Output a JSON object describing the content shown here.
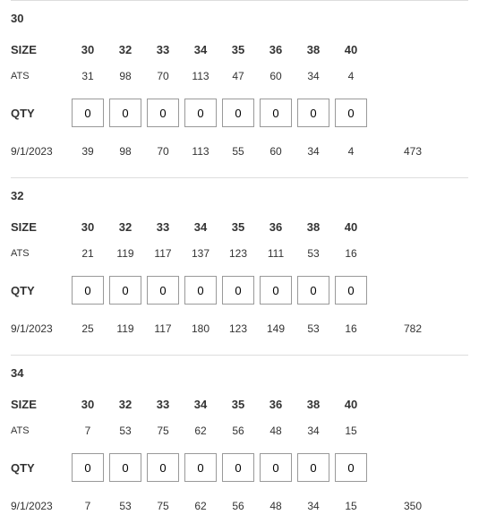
{
  "labels": {
    "size": "SIZE",
    "ats": "ATS",
    "qty": "QTY"
  },
  "groups": [
    {
      "title": "30",
      "sizes": [
        "30",
        "32",
        "33",
        "34",
        "35",
        "36",
        "38",
        "40"
      ],
      "ats": [
        "31",
        "98",
        "70",
        "113",
        "47",
        "60",
        "34",
        "4"
      ],
      "qty": [
        "0",
        "0",
        "0",
        "0",
        "0",
        "0",
        "0",
        "0"
      ],
      "date": "9/1/2023",
      "dateVals": [
        "39",
        "98",
        "70",
        "113",
        "55",
        "60",
        "34",
        "4"
      ],
      "total": "473"
    },
    {
      "title": "32",
      "sizes": [
        "30",
        "32",
        "33",
        "34",
        "35",
        "36",
        "38",
        "40"
      ],
      "ats": [
        "21",
        "119",
        "117",
        "137",
        "123",
        "111",
        "53",
        "16"
      ],
      "qty": [
        "0",
        "0",
        "0",
        "0",
        "0",
        "0",
        "0",
        "0"
      ],
      "date": "9/1/2023",
      "dateVals": [
        "25",
        "119",
        "117",
        "180",
        "123",
        "149",
        "53",
        "16"
      ],
      "total": "782"
    },
    {
      "title": "34",
      "sizes": [
        "30",
        "32",
        "33",
        "34",
        "35",
        "36",
        "38",
        "40"
      ],
      "ats": [
        "7",
        "53",
        "75",
        "62",
        "56",
        "48",
        "34",
        "15"
      ],
      "qty": [
        "0",
        "0",
        "0",
        "0",
        "0",
        "0",
        "0",
        "0"
      ],
      "date": "9/1/2023",
      "dateVals": [
        "7",
        "53",
        "75",
        "62",
        "56",
        "48",
        "34",
        "15"
      ],
      "total": "350"
    }
  ]
}
